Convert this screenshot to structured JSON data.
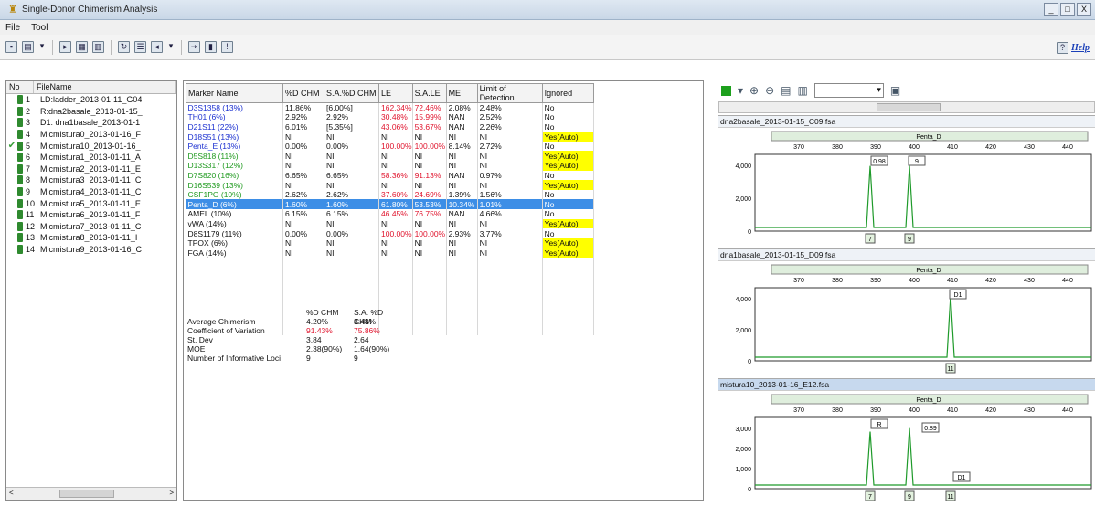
{
  "window": {
    "title": "Single-Donor Chimerism Analysis",
    "controls": [
      "_",
      "□",
      "X"
    ]
  },
  "menu": [
    "File",
    "Tool"
  ],
  "help": "Help",
  "files": {
    "headers": [
      "No",
      "FileName"
    ],
    "rows": [
      {
        "no": "1",
        "name": "LD:ladder_2013-01-11_G04",
        "checked": false
      },
      {
        "no": "2",
        "name": "R:dna2basale_2013-01-15_",
        "checked": false
      },
      {
        "no": "3",
        "name": "D1: dna1basale_2013-01-1",
        "checked": false
      },
      {
        "no": "4",
        "name": "Micmistura0_2013-01-16_F",
        "checked": false
      },
      {
        "no": "5",
        "name": "Micmistura10_2013-01-16_",
        "checked": true
      },
      {
        "no": "6",
        "name": "Micmistura1_2013-01-11_A",
        "checked": false
      },
      {
        "no": "7",
        "name": "Micmistura2_2013-01-11_E",
        "checked": false
      },
      {
        "no": "8",
        "name": "Micmistura3_2013-01-11_C",
        "checked": false
      },
      {
        "no": "9",
        "name": "Micmistura4_2013-01-11_C",
        "checked": false
      },
      {
        "no": "10",
        "name": "Micmistura5_2013-01-11_E",
        "checked": false
      },
      {
        "no": "11",
        "name": "Micmistura6_2013-01-11_F",
        "checked": false
      },
      {
        "no": "12",
        "name": "Micmistura7_2013-01-11_C",
        "checked": false
      },
      {
        "no": "13",
        "name": "Micmistura8_2013-01-11_I",
        "checked": false
      },
      {
        "no": "14",
        "name": "Micmistura9_2013-01-16_C",
        "checked": false
      }
    ],
    "scroll_left": "<",
    "scroll_right": ">"
  },
  "markers": {
    "headers": [
      "Marker Name",
      "%D CHM",
      "S.A.%D CHM",
      "LE",
      "S.A.LE",
      "ME",
      "Limit of Detection",
      "Ignored"
    ],
    "rows": [
      {
        "name": "D3S1358 (13%)",
        "color": "blue",
        "d": "11.86%",
        "sad": "[6.00%]",
        "le": "162.34%",
        "sale": "72.46%",
        "me": "2.08%",
        "lod": "2.48%",
        "ign": "No",
        "red": true,
        "yel": false
      },
      {
        "name": "TH01 (6%)",
        "color": "blue",
        "d": "2.92%",
        "sad": "2.92%",
        "le": "30.48%",
        "sale": "15.99%",
        "me": "NAN",
        "lod": "2.52%",
        "ign": "No",
        "red": true,
        "yel": false
      },
      {
        "name": "D21S11 (22%)",
        "color": "blue",
        "d": "6.01%",
        "sad": "[5.35%]",
        "le": "43.06%",
        "sale": "53.67%",
        "me": "NAN",
        "lod": "2.26%",
        "ign": "No",
        "red": true,
        "yel": false
      },
      {
        "name": "D18S51 (13%)",
        "color": "blue",
        "d": "NI",
        "sad": "NI",
        "le": "NI",
        "sale": "NI",
        "me": "NI",
        "lod": "NI",
        "ign": "Yes(Auto)",
        "red": false,
        "yel": true
      },
      {
        "name": "Penta_E (13%)",
        "color": "blue",
        "d": "0.00%",
        "sad": "0.00%",
        "le": "100.00%",
        "sale": "100.00%",
        "me": "8.14%",
        "lod": "2.72%",
        "ign": "No",
        "red": true,
        "yel": false
      },
      {
        "name": "D5S818 (11%)",
        "color": "green",
        "d": "NI",
        "sad": "NI",
        "le": "NI",
        "sale": "NI",
        "me": "NI",
        "lod": "NI",
        "ign": "Yes(Auto)",
        "red": false,
        "yel": true
      },
      {
        "name": "D13S317 (12%)",
        "color": "green",
        "d": "NI",
        "sad": "NI",
        "le": "NI",
        "sale": "NI",
        "me": "NI",
        "lod": "NI",
        "ign": "Yes(Auto)",
        "red": false,
        "yel": true
      },
      {
        "name": "D7S820 (16%)",
        "color": "green",
        "d": "6.65%",
        "sad": "6.65%",
        "le": "58.36%",
        "sale": "91.13%",
        "me": "NAN",
        "lod": "0.97%",
        "ign": "No",
        "red": true,
        "yel": false
      },
      {
        "name": "D16S539 (13%)",
        "color": "green",
        "d": "NI",
        "sad": "NI",
        "le": "NI",
        "sale": "NI",
        "me": "NI",
        "lod": "NI",
        "ign": "Yes(Auto)",
        "red": false,
        "yel": true
      },
      {
        "name": "CSF1PO (10%)",
        "color": "green",
        "d": "2.62%",
        "sad": "2.62%",
        "le": "37.60%",
        "sale": "24.69%",
        "me": "1.39%",
        "lod": "1.56%",
        "ign": "No",
        "red": true,
        "yel": false
      },
      {
        "name": "Penta_D (6%)",
        "color": "green",
        "d": "1.60%",
        "sad": "1.60%",
        "le": "61.80%",
        "sale": "53.53%",
        "me": "10.34%",
        "lod": "1.01%",
        "ign": "No",
        "red": true,
        "yel": false,
        "selected": true
      },
      {
        "name": "AMEL (10%)",
        "color": "black",
        "d": "6.15%",
        "sad": "6.15%",
        "le": "46.45%",
        "sale": "76.75%",
        "me": "NAN",
        "lod": "4.66%",
        "ign": "No",
        "red": true,
        "yel": false
      },
      {
        "name": "vWA (14%)",
        "color": "black",
        "d": "NI",
        "sad": "NI",
        "le": "NI",
        "sale": "NI",
        "me": "NI",
        "lod": "NI",
        "ign": "Yes(Auto)",
        "red": false,
        "yel": true
      },
      {
        "name": "D8S1179 (11%)",
        "color": "black",
        "d": "0.00%",
        "sad": "0.00%",
        "le": "100.00%",
        "sale": "100.00%",
        "me": "2.93%",
        "lod": "3.77%",
        "ign": "No",
        "red": true,
        "yel": false
      },
      {
        "name": "TPOX (6%)",
        "color": "black",
        "d": "NI",
        "sad": "NI",
        "le": "NI",
        "sale": "NI",
        "me": "NI",
        "lod": "NI",
        "ign": "Yes(Auto)",
        "red": false,
        "yel": true
      },
      {
        "name": "FGA (14%)",
        "color": "black",
        "d": "NI",
        "sad": "NI",
        "le": "NI",
        "sale": "NI",
        "me": "NI",
        "lod": "NI",
        "ign": "Yes(Auto)",
        "red": false,
        "yel": true
      }
    ]
  },
  "stats": {
    "head": [
      "%D CHM",
      "S.A. %D CHM"
    ],
    "rows": [
      {
        "label": "Average Chimerism",
        "a": "4.20%",
        "b": "3.48%",
        "red": false
      },
      {
        "label": "Coefficient of Variation",
        "a": "91.43%",
        "b": "75.86%",
        "red": true
      },
      {
        "label": "St. Dev",
        "a": "3.84",
        "b": "2.64",
        "red": false
      },
      {
        "label": "MOE",
        "a": "2.38(90%)",
        "b": "1.64(90%)",
        "red": false
      },
      {
        "label": "Number of Informative Loci",
        "a": "9",
        "b": "9",
        "red": false
      }
    ]
  },
  "traces": [
    {
      "file": "dna2basale_2013-01-15_C09.fsa",
      "marker": "Penta_D",
      "ticks": [
        "370",
        "380",
        "390",
        "400",
        "410",
        "420",
        "430",
        "440"
      ],
      "yticks": [
        "4,000",
        "2,000",
        "0"
      ],
      "peak_boxes": [
        "0.98",
        "9"
      ],
      "alleles": [
        "7",
        "9"
      ]
    },
    {
      "file": "dna1basale_2013-01-15_D09.fsa",
      "marker": "Penta_D",
      "ticks": [
        "370",
        "380",
        "390",
        "400",
        "410",
        "420",
        "430",
        "440"
      ],
      "yticks": [
        "4,000",
        "2,000",
        "0"
      ],
      "peak_boxes": [
        "D1"
      ],
      "alleles": [
        "11"
      ]
    },
    {
      "file": "mistura10_2013-01-16_E12.fsa",
      "marker": "Penta_D",
      "ticks": [
        "370",
        "380",
        "390",
        "400",
        "410",
        "420",
        "430",
        "440"
      ],
      "yticks": [
        "3,000",
        "2,000",
        "1,000",
        "0"
      ],
      "peak_boxes": [
        "R",
        "0.89",
        "D1"
      ],
      "alleles": [
        "7",
        "9",
        "11"
      ]
    }
  ]
}
